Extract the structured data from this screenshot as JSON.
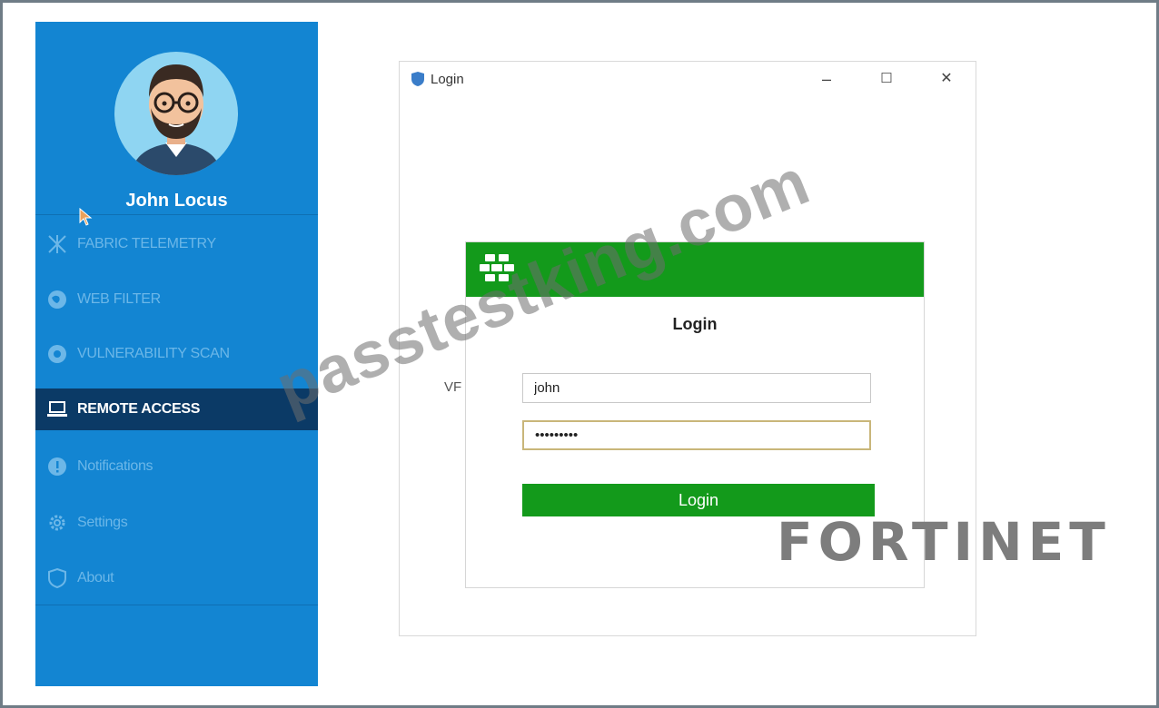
{
  "sidebar": {
    "user_name": "John Locus",
    "items": [
      {
        "label": "FABRIC TELEMETRY",
        "icon": "fabric-telemetry-icon"
      },
      {
        "label": "WEB FILTER",
        "icon": "web-filter-icon"
      },
      {
        "label": "VULNERABILITY SCAN",
        "icon": "vulnerability-scan-icon"
      },
      {
        "label": "REMOTE ACCESS",
        "icon": "laptop-icon",
        "active": true
      },
      {
        "label": "Notifications",
        "icon": "notification-icon"
      },
      {
        "label": "Settings",
        "icon": "gear-icon"
      },
      {
        "label": "About",
        "icon": "shield-icon"
      }
    ]
  },
  "window": {
    "title": "Login",
    "minimize": "–",
    "maximize": "☐",
    "close": "✕"
  },
  "login": {
    "heading": "Login",
    "vpn_label": "VF",
    "username_value": "john",
    "password_value": "•••••••••",
    "button_label": "Login"
  },
  "watermark": "passtestking.com",
  "brand": "FORTINET",
  "colors": {
    "sidebar": "#1385d2",
    "sidebar_active": "#0b3a66",
    "green": "#139a1b"
  }
}
